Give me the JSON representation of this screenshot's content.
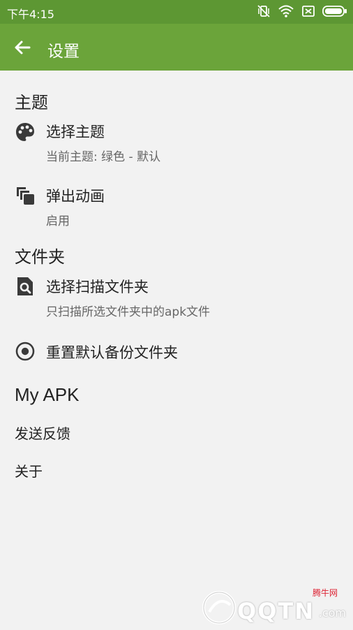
{
  "status_bar": {
    "time": "下午4:15",
    "icons": [
      "vibrate-off-icon",
      "wifi-icon",
      "sim-off-icon",
      "battery-icon"
    ]
  },
  "app_bar": {
    "title": "设置",
    "color": "#6ba43a"
  },
  "sections": {
    "theme": {
      "title": "主题",
      "items": [
        {
          "icon": "palette-icon",
          "title": "选择主题",
          "summary": "当前主题: 绿色 - 默认"
        },
        {
          "icon": "copy-animation-icon",
          "title": "弹出动画",
          "summary": "启用"
        }
      ]
    },
    "folder": {
      "title": "文件夹",
      "items": [
        {
          "icon": "folder-search-icon",
          "title": "选择扫描文件夹",
          "summary": "只扫描所选文件夹中的apk文件"
        },
        {
          "icon": "radio-target-icon",
          "title": "重置默认备份文件夹"
        }
      ]
    },
    "myapk": {
      "title": "My APK",
      "items": [
        {
          "title": "发送反馈"
        },
        {
          "title": "关于"
        }
      ]
    }
  },
  "watermark": {
    "line1": "腾牛网",
    "line2": "QQTN",
    "line3": ".com"
  }
}
